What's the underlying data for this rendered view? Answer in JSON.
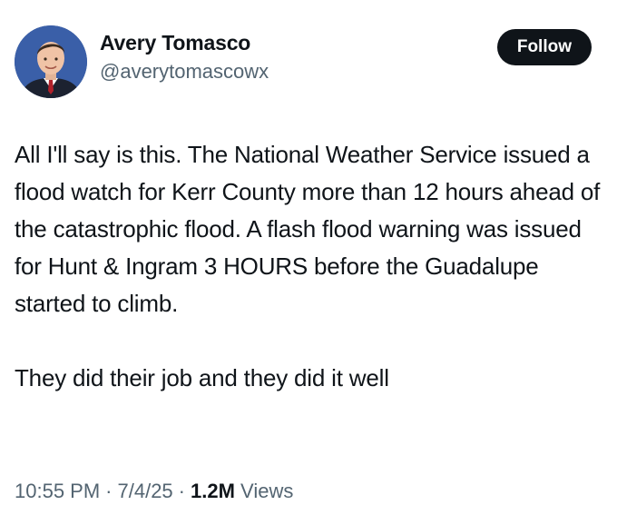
{
  "author": {
    "display_name": "Avery Tomasco",
    "handle": "@averytomascowx"
  },
  "follow_button": {
    "label": "Follow"
  },
  "tweet": {
    "paragraphs": [
      "All I'll say is this. The National Weather Service issued a flood watch for Kerr County more than 12 hours ahead of the catastrophic flood. A flash flood warning was issued for Hunt & Ingram 3 HOURS before the Guadalupe started to climb.",
      "They did their job and they did it well"
    ]
  },
  "meta": {
    "time": "10:55 PM",
    "date": "7/4/25",
    "separator": "·",
    "views_count": "1.2M",
    "views_label": "Views"
  },
  "colors": {
    "text_primary": "#0f1419",
    "text_secondary": "#536471",
    "button_bg": "#0f1419",
    "button_text": "#ffffff"
  },
  "icons": {
    "avatar": "profile-photo"
  }
}
